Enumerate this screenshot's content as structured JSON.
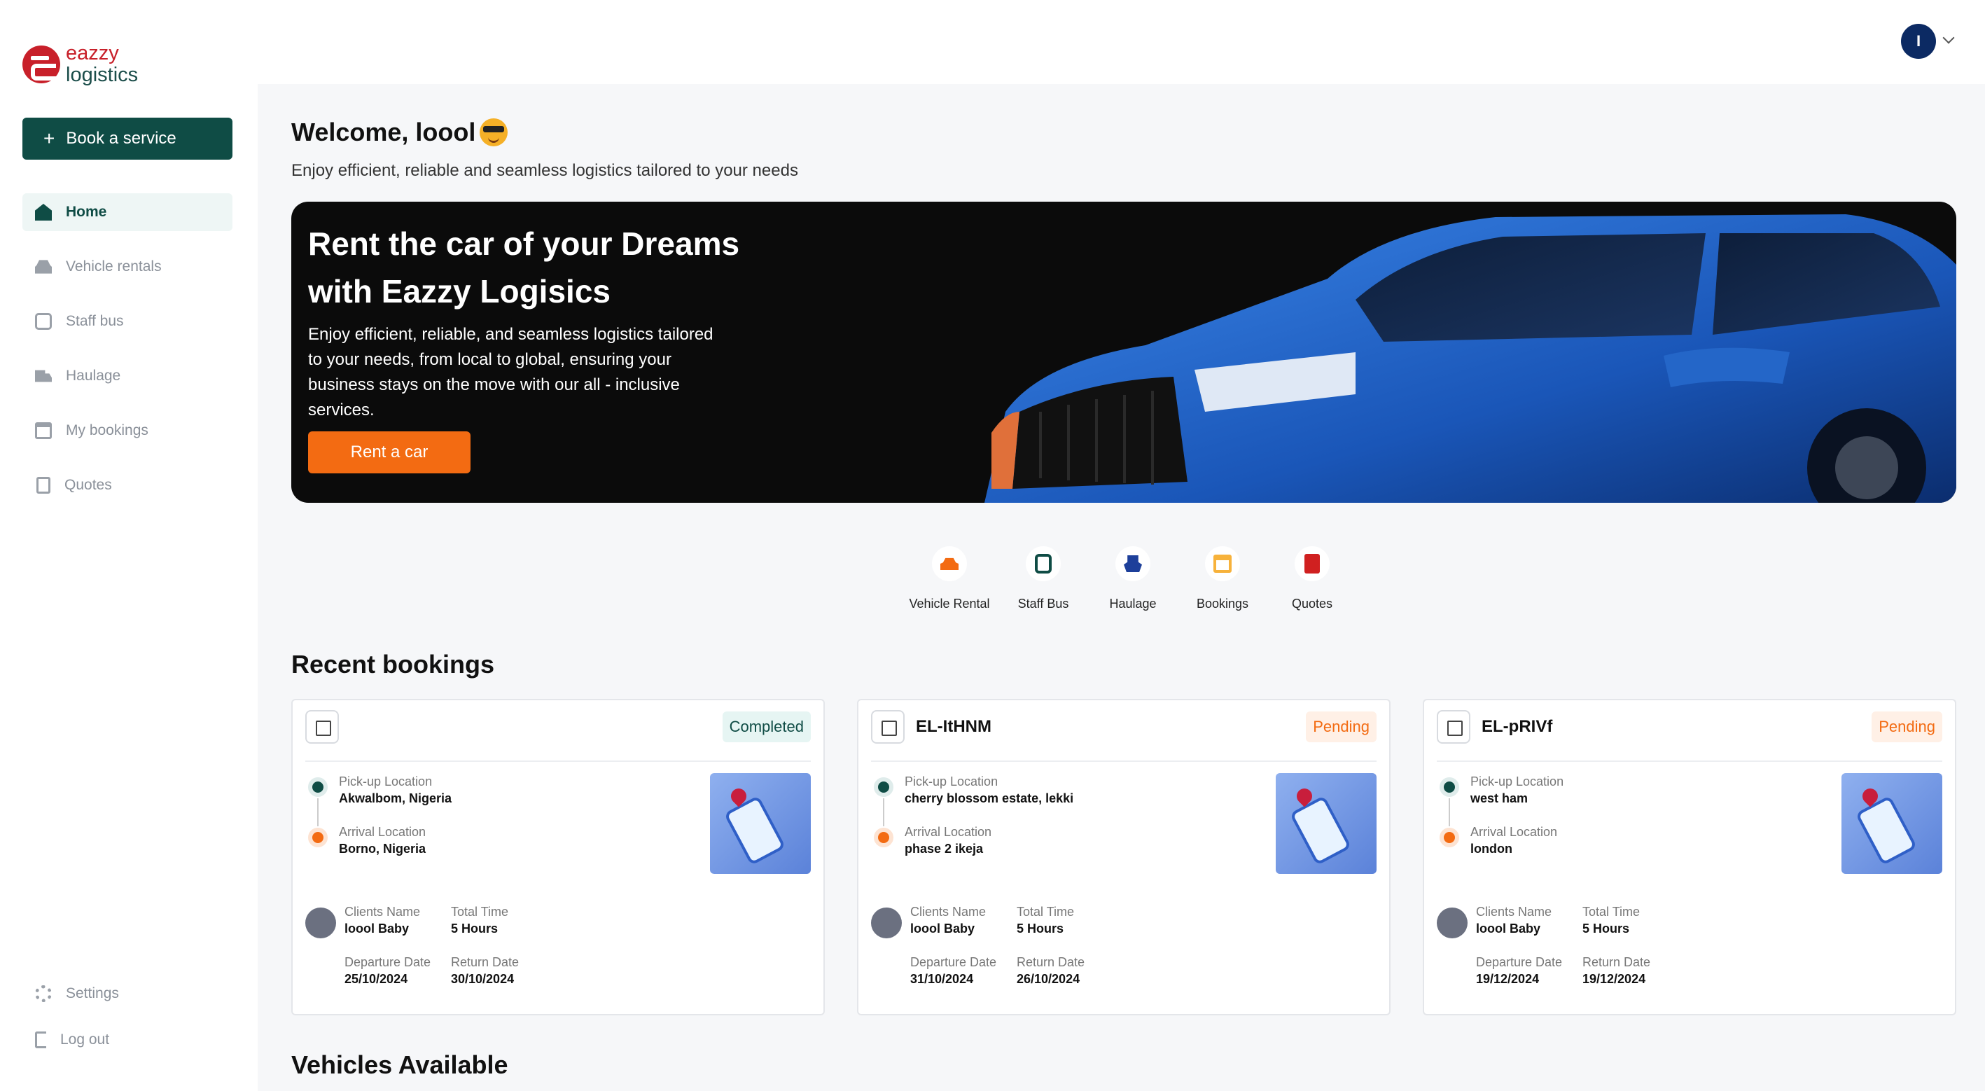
{
  "brand": {
    "line1": "eazzy",
    "line2": "logistics",
    "color": "#c8202a"
  },
  "sidebar": {
    "book_button": "Book a service",
    "items": [
      {
        "label": "Home",
        "icon": "home-icon",
        "active": true
      },
      {
        "label": "Vehicle rentals",
        "icon": "car-icon"
      },
      {
        "label": "Staff bus",
        "icon": "bus-icon"
      },
      {
        "label": "Haulage",
        "icon": "truck-icon"
      },
      {
        "label": "My bookings",
        "icon": "calendar-icon"
      },
      {
        "label": "Quotes",
        "icon": "clipboard-icon"
      }
    ],
    "bottom": [
      {
        "label": "Settings",
        "icon": "gear-icon"
      },
      {
        "label": "Log out",
        "icon": "logout-icon"
      }
    ]
  },
  "header": {
    "avatar_initial": "I"
  },
  "welcome": {
    "title": "Welcome, loool",
    "subtitle": "Enjoy efficient, reliable and seamless logistics tailored to your needs"
  },
  "hero": {
    "title": "Rent the car of your Dreams with Eazzy Logisics",
    "text": "Enjoy efficient, reliable, and seamless logistics tailored to your needs, from local to global, ensuring your business stays on the move with our all - inclusive services.",
    "button": "Rent a car"
  },
  "quick_actions": [
    {
      "label": "Vehicle Rental",
      "icon": "car-icon"
    },
    {
      "label": "Staff Bus",
      "icon": "bus-icon"
    },
    {
      "label": "Haulage",
      "icon": "ship-icon"
    },
    {
      "label": "Bookings",
      "icon": "calendar-icon"
    },
    {
      "label": "Quotes",
      "icon": "quote-icon"
    }
  ],
  "recent_bookings": {
    "title": "Recent bookings",
    "labels": {
      "pickup": "Pick-up Location",
      "arrival": "Arrival Location",
      "client": "Clients Name",
      "total_time": "Total Time",
      "departure": "Departure Date",
      "return": "Return Date"
    },
    "cards": [
      {
        "ref": "",
        "status": "Completed",
        "pickup": "Akwalbom, Nigeria",
        "arrival": "Borno, Nigeria",
        "client": "loool Baby",
        "total_time": "5 Hours",
        "departure": "25/10/2024",
        "return": "30/10/2024"
      },
      {
        "ref": "EL-ItHNM",
        "status": "Pending",
        "pickup": "cherry blossom estate, lekki",
        "arrival": "phase 2 ikeja",
        "client": "loool Baby",
        "total_time": "5 Hours",
        "departure": "31/10/2024",
        "return": "26/10/2024"
      },
      {
        "ref": "EL-pRIVf",
        "status": "Pending",
        "pickup": "west ham",
        "arrival": "london",
        "client": "loool Baby",
        "total_time": "5 Hours",
        "departure": "19/12/2024",
        "return": "19/12/2024"
      }
    ]
  },
  "vehicles_available": {
    "title": "Vehicles Available"
  },
  "colors": {
    "primary": "#0f4c45",
    "accent": "#f36b12",
    "completed_bg": "#e6f5f3",
    "pending_bg": "#fff0e6"
  }
}
